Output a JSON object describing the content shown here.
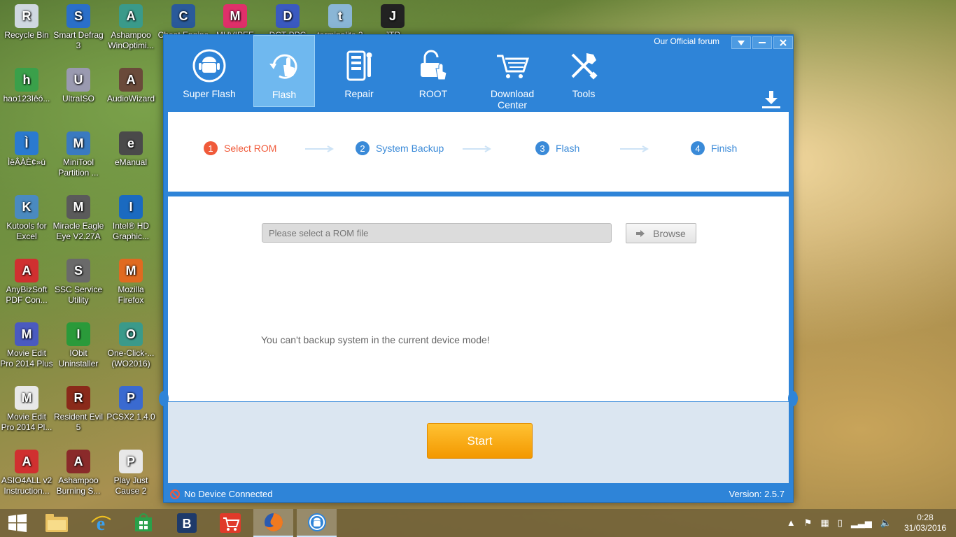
{
  "desktop": {
    "icons": [
      {
        "label": "Recycle Bin",
        "icon": "recycle-bin-icon",
        "color": "#d0d8e0"
      },
      {
        "label": "Smart Defrag 3",
        "icon": "defrag-icon",
        "color": "#2a6fc9"
      },
      {
        "label": "Ashampoo WinOptimi...",
        "icon": "ashampoo-icon",
        "color": "#3a9a8a"
      },
      {
        "label": "Cheat Engine",
        "icon": "cheat-engine-icon",
        "color": "#2a5a9a"
      },
      {
        "label": "MUVIPEE",
        "icon": "muvipee-icon",
        "color": "#e0306a"
      },
      {
        "label": "DCT-PPC",
        "icon": "dct-icon",
        "color": "#3a5ac0"
      },
      {
        "label": "terminalite 3",
        "icon": "terminal-icon",
        "color": "#8ab6d6"
      },
      {
        "label": "JTR",
        "icon": "yin-yang-icon",
        "color": "#222222"
      },
      {
        "label": "hao123Iêó...",
        "icon": "hao123-icon",
        "color": "#3aa04a"
      },
      {
        "label": "UltraISO",
        "icon": "disc-icon",
        "color": "#9a9ab0"
      },
      {
        "label": "AudioWizard",
        "icon": "audio-icon",
        "color": "#6a4a3a"
      },
      {
        "label": "ÌêÂÀÈ¢»ú",
        "icon": "app-icon",
        "color": "#2a7ad0"
      },
      {
        "label": "MiniTool Partition ...",
        "icon": "minitool-icon",
        "color": "#3a7ac0"
      },
      {
        "label": "eManual",
        "icon": "emanual-icon",
        "color": "#4a4a4a"
      },
      {
        "label": "Kutools for Excel",
        "icon": "kutools-icon",
        "color": "#4a8ac0"
      },
      {
        "label": "Miracle Eagle Eye V2.27A",
        "icon": "eagle-icon",
        "color": "#5a5a5a"
      },
      {
        "label": "Intel® HD Graphic...",
        "icon": "intel-icon",
        "color": "#1a6ac0"
      },
      {
        "label": "AnyBizSoft PDF Con...",
        "icon": "pdf-icon",
        "color": "#d03030"
      },
      {
        "label": "SSC Service Utility",
        "icon": "printer-icon",
        "color": "#6a6a6a"
      },
      {
        "label": "Mozilla Firefox",
        "icon": "firefox-icon",
        "color": "#e06a20"
      },
      {
        "label": "Movie Edit Pro 2014 Plus",
        "icon": "movie-icon",
        "color": "#4a5ac0"
      },
      {
        "label": "IObit Uninstaller",
        "icon": "iobit-icon",
        "color": "#2a9a3a"
      },
      {
        "label": "One-Click-... (WO2016)",
        "icon": "oneclick-icon",
        "color": "#3a9a8a"
      },
      {
        "label": "Movie Edit Pro 2014 Pl...",
        "icon": "file-icon",
        "color": "#e8e8e8"
      },
      {
        "label": "Resident Evil 5",
        "icon": "re5-icon",
        "color": "#8a2a1a"
      },
      {
        "label": "PCSX2 1.4.0",
        "icon": "pcsx2-icon",
        "color": "#3a6ad0"
      },
      {
        "label": "ASIO4ALL v2 Instruction...",
        "icon": "asio-icon",
        "color": "#d03030"
      },
      {
        "label": "Ashampoo Burning S...",
        "icon": "burning-icon",
        "color": "#8a2a2a"
      },
      {
        "label": "Play Just Cause 2",
        "icon": "justcause-icon",
        "color": "#e8e8e8"
      }
    ]
  },
  "app": {
    "forum_link": "Our Official forum",
    "tabs": [
      {
        "label": "Super Flash",
        "icon": "android-icon"
      },
      {
        "label": "Flash",
        "icon": "flash-icon"
      },
      {
        "label": "Repair",
        "icon": "repair-icon"
      },
      {
        "label": "ROOT",
        "icon": "unlock-icon"
      },
      {
        "label": "Download Center",
        "icon": "cart-icon"
      },
      {
        "label": "Tools",
        "icon": "tools-icon"
      }
    ],
    "steps": [
      {
        "num": "1",
        "label": "Select ROM"
      },
      {
        "num": "2",
        "label": "System Backup"
      },
      {
        "num": "3",
        "label": "Flash"
      },
      {
        "num": "4",
        "label": "Finish"
      }
    ],
    "rom_placeholder": "Please select a ROM file",
    "browse_label": "Browse",
    "message": "You can't backup system in the current device mode!",
    "start_label": "Start",
    "status": "No Device Connected",
    "version": "Version: 2.5.7",
    "colors": {
      "accent": "#2e84d8",
      "active_step": "#f05a3a",
      "step": "#3a8ad8",
      "start": "#f7a800"
    }
  },
  "taskbar": {
    "time": "0:28",
    "date": "31/03/2016"
  }
}
